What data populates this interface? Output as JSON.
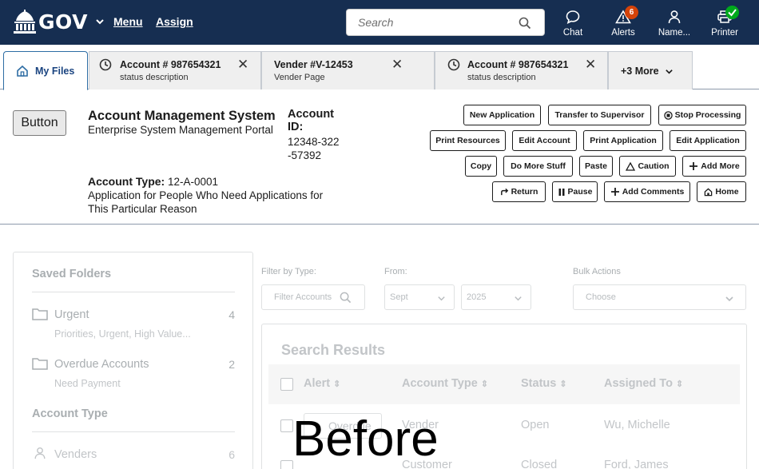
{
  "topbar": {
    "logo_text": "GOV",
    "menu_label": "Menu",
    "assign_label": "Assign",
    "search_placeholder": "Search",
    "tools": [
      {
        "label": "Chat",
        "icon": "chat-bubble-icon"
      },
      {
        "label": "Alerts",
        "icon": "warning-triangle-icon",
        "badge": "6"
      },
      {
        "label": "Name...",
        "icon": "person-icon"
      },
      {
        "label": "Printer",
        "icon": "printer-icon",
        "status": "ok"
      }
    ],
    "colors": {
      "bar": "#162e51",
      "alert_badge": "#d54309",
      "ok_badge": "#00a91c"
    }
  },
  "tabs": [
    {
      "title": "My Files",
      "icon": "home-icon",
      "active": true
    },
    {
      "title": "Account # 987654321",
      "subtitle": "status description",
      "icon": "clock-icon"
    },
    {
      "title": "Vender #V-12453",
      "subtitle": "Vender Page"
    },
    {
      "title": "Account # 987654321",
      "subtitle": "status description",
      "icon": "clock-icon"
    },
    {
      "title": "+3 More"
    }
  ],
  "header": {
    "button_label": "Button",
    "system_title": "Account Management System",
    "system_subtitle": "Enterprise System Management Portal",
    "account_id_label": "Account ID:",
    "account_id_value": "12348-322 -57392",
    "account_type_label": "Account Type:",
    "account_type_value": "12-A-0001",
    "account_description": "Application for People Who Need Applications for This Particular Reason"
  },
  "actions": {
    "new_application": "New Application",
    "transfer": "Transfer to Supervisor",
    "stop_processing": "Stop Processing",
    "print_resources": "Print Resources",
    "edit_account": "Edit Account",
    "print_application": "Print Application",
    "edit_application": "Edit Application",
    "copy": "Copy",
    "do_more_stuff": "Do More Stuff",
    "paste": "Paste",
    "caution": "Caution",
    "add_more": "Add More",
    "return": "Return",
    "pause": "Pause",
    "add_comments": "Add Comments",
    "home": "Home"
  },
  "sidebar": {
    "saved_folders_title": "Saved Folders",
    "folders": [
      {
        "name": "Urgent",
        "count": "4",
        "sub": "Priorities, Urgent, High Value..."
      },
      {
        "name": "Overdue Accounts",
        "count": "2",
        "sub": "Need Payment"
      }
    ],
    "account_type_title": "Account Type",
    "types": [
      {
        "name": "Venders",
        "count": "6"
      }
    ]
  },
  "filters": {
    "filter_label": "Filter by Type:",
    "filter_placeholder": "Filter Accounts",
    "from_label": "From:",
    "month": "Sept",
    "year": "2025",
    "bulk_label": "Bulk Actions",
    "bulk_value": "Choose"
  },
  "results": {
    "title": "Search Results",
    "columns": [
      "Alert",
      "Account Type",
      "Status",
      "Assigned To"
    ],
    "rows": [
      {
        "alert": "Overdue",
        "type": "Vender",
        "status": "Open",
        "assigned": "Wu, Michelle"
      },
      {
        "alert": "",
        "type": "Customer",
        "status": "Closed",
        "assigned": "Ford, James"
      }
    ]
  },
  "watermark": "Before"
}
